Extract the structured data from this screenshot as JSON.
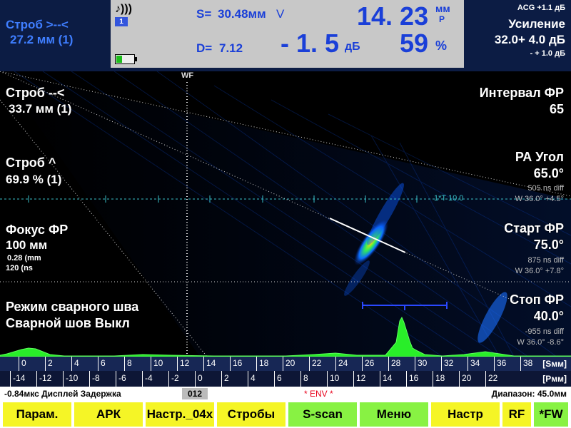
{
  "gate_top": {
    "label": "Строб >--<",
    "value": "27.2 мм (1)"
  },
  "reading": {
    "s_label": "S=",
    "s_value": "30.48мм",
    "s_mark": "V",
    "d_label": "D=",
    "d_value": "7.12",
    "depth_value": "14. 23",
    "depth_unit_top": "мм",
    "depth_unit_bottom": "Р",
    "db_value": "- 1. 5",
    "db_unit": "дБ",
    "amp_value": "59",
    "amp_unit": "%",
    "page_indicator": "1"
  },
  "gain": {
    "acg": "ACG +1.1 дБ",
    "title": "Усиление",
    "value": "32.0+ 4.0 дБ",
    "step": "- + 1.0 дБ"
  },
  "overlay_left": {
    "gate_b_label": "Строб --<",
    "gate_b_value": "33.7 мм (1)",
    "gate_a_label": "Строб ^",
    "gate_a_value": "69.9 % (1)",
    "focus_label": "Фокус ФР",
    "focus_value": "100 мм",
    "focus_sub1": "0.28 (mm",
    "focus_sub2": "120 (ns",
    "weld_mode": "Режим сварного шва",
    "weld_state": "Сварной шов Выкл"
  },
  "overlay_right": {
    "interval_label": "Интервал ФР",
    "interval_value": "65",
    "angle_label": "РА Угол",
    "angle_value": "65.0°",
    "angle_sub1": "505 ns diff",
    "angle_sub2": "W 36.0° +4.5°",
    "start_label": "Старт ФР",
    "start_value": "75.0°",
    "start_sub1": "875 ns diff",
    "start_sub2": "W 36.0° +7.8°",
    "stop_label": "Стоп ФР",
    "stop_value": "40.0°",
    "stop_sub1": "-955 ns diff",
    "stop_sub2": "W 36.0° -8.6°"
  },
  "scan_labels": {
    "wf": "WF",
    "leg": "1*T  10.0"
  },
  "scale_top": {
    "ticks": [
      "0",
      "2",
      "4",
      "6",
      "8",
      "10",
      "12",
      "14",
      "16",
      "18",
      "20",
      "22",
      "24",
      "26",
      "28",
      "30",
      "32",
      "34",
      "36",
      "38"
    ],
    "unit": "[Sмм]"
  },
  "scale_bottom": {
    "ticks": [
      "-14",
      "-12",
      "-10",
      "-8",
      "-6",
      "-4",
      "-2",
      "0",
      "2",
      "4",
      "6",
      "8",
      "10",
      "12",
      "14",
      "16",
      "18",
      "20",
      "22"
    ],
    "unit": "[Pмм]"
  },
  "status": {
    "delay": "-0.84мкс  Дисплей Задержка",
    "page": "012",
    "env": "* ENV *",
    "range": "Диапазон:  45.0мм"
  },
  "buttons": [
    {
      "label": "Парам.",
      "color": "yellow"
    },
    {
      "label": "АРК",
      "color": "yellow"
    },
    {
      "label": "Настр._04x",
      "color": "yellow"
    },
    {
      "label": "Стробы",
      "color": "yellow"
    },
    {
      "label": "S-scan",
      "color": "green"
    },
    {
      "label": "Меню",
      "color": "green"
    },
    {
      "label": "Настр",
      "color": "yellow"
    },
    {
      "label": "RF",
      "color": "yellow"
    },
    {
      "label": "*FW",
      "color": "green"
    }
  ]
}
